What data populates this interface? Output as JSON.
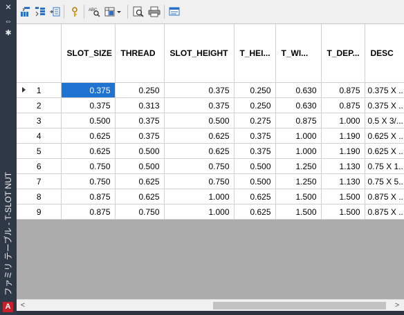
{
  "sidebar": {
    "title": "ファミリ テーブル - T-SLOT NUT",
    "logo": "A"
  },
  "toolbar": {
    "icons": [
      "insert-column-icon",
      "insert-row-icon",
      "add-item-icon",
      "lock-icon",
      "find-replace-icon",
      "filter-icon",
      "preview-icon",
      "print-icon",
      "format-icon"
    ]
  },
  "grid": {
    "columns": [
      "SLOT_SIZE",
      "THREAD",
      "SLOT_HEIGHT",
      "T_HEI...",
      "T_WI...",
      "T_DEP...",
      "DESC"
    ],
    "rows": [
      {
        "num": "1",
        "cells": [
          "0.375",
          "0.250",
          "0.375",
          "0.250",
          "0.630",
          "0.875",
          "0.375 X ..."
        ]
      },
      {
        "num": "2",
        "cells": [
          "0.375",
          "0.313",
          "0.375",
          "0.250",
          "0.630",
          "0.875",
          "0.375 X ..."
        ]
      },
      {
        "num": "3",
        "cells": [
          "0.500",
          "0.375",
          "0.500",
          "0.275",
          "0.875",
          "1.000",
          "0.5 X 3/..."
        ]
      },
      {
        "num": "4",
        "cells": [
          "0.625",
          "0.375",
          "0.625",
          "0.375",
          "1.000",
          "1.190",
          "0.625 X ..."
        ]
      },
      {
        "num": "5",
        "cells": [
          "0.625",
          "0.500",
          "0.625",
          "0.375",
          "1.000",
          "1.190",
          "0.625 X ..."
        ]
      },
      {
        "num": "6",
        "cells": [
          "0.750",
          "0.500",
          "0.750",
          "0.500",
          "1.250",
          "1.130",
          "0.75 X 1..."
        ]
      },
      {
        "num": "7",
        "cells": [
          "0.750",
          "0.625",
          "0.750",
          "0.500",
          "1.250",
          "1.130",
          "0.75 X 5..."
        ]
      },
      {
        "num": "8",
        "cells": [
          "0.875",
          "0.625",
          "1.000",
          "0.625",
          "1.500",
          "1.500",
          "0.875 X ..."
        ]
      },
      {
        "num": "9",
        "cells": [
          "0.875",
          "0.750",
          "1.000",
          "0.625",
          "1.500",
          "1.500",
          "0.875 X ..."
        ]
      }
    ]
  },
  "colors": {
    "selection": "#1e74d0",
    "frame": "#2b3340"
  }
}
